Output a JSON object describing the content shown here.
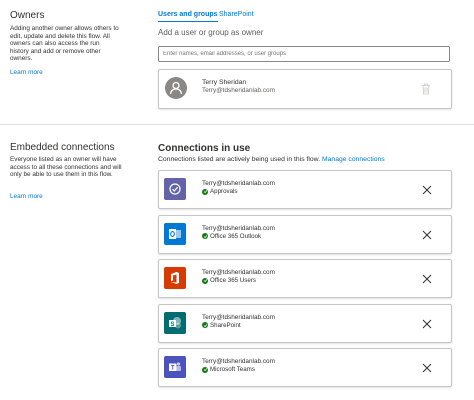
{
  "owners": {
    "title": "Owners",
    "description": "Adding another owner allows others to edit, update and delete this flow. All owners can also access the run history and add or remove other owners.",
    "learn_more": "Learn more",
    "tabs": [
      {
        "label": "Users and groups",
        "active": true
      },
      {
        "label": "SharePoint",
        "active": false
      }
    ],
    "add_label": "Add a user or group as owner",
    "search_placeholder": "Enter names, email addresses, or user groups",
    "owner": {
      "name": "Terry Sheridan",
      "email": "Terry@tdsheridanlab.com"
    }
  },
  "embedded": {
    "title": "Embedded connections",
    "description": "Everyone listed as an owner will have access to all these connections and will only be able to use them in this flow.",
    "learn_more": "Learn more"
  },
  "connections": {
    "title": "Connections in use",
    "subtitle": "Connections listed are actively being used in this flow.",
    "manage_link": "Manage connections",
    "items": [
      {
        "email": "Terry@tdsheridanlab.com",
        "name": "Approvals",
        "icon": "approvals-icon",
        "color": "#6264a7"
      },
      {
        "email": "Terry@tdsheridanlab.com",
        "name": "Office 365 Outlook",
        "icon": "outlook-icon",
        "color": "#0078d4"
      },
      {
        "email": "Terry@tdsheridanlab.com",
        "name": "Office 365 Users",
        "icon": "office-icon",
        "color": "#d83b01"
      },
      {
        "email": "Terry@tdsheridanlab.com",
        "name": "SharePoint",
        "icon": "sharepoint-icon",
        "color": "#036c70"
      },
      {
        "email": "Terry@tdsheridanlab.com",
        "name": "Microsoft Teams",
        "icon": "teams-icon",
        "color": "#4b53bc"
      }
    ]
  },
  "colors": {
    "accent": "#0078d4",
    "status_ok": "#107c10",
    "divider": "#e1dfdd"
  }
}
